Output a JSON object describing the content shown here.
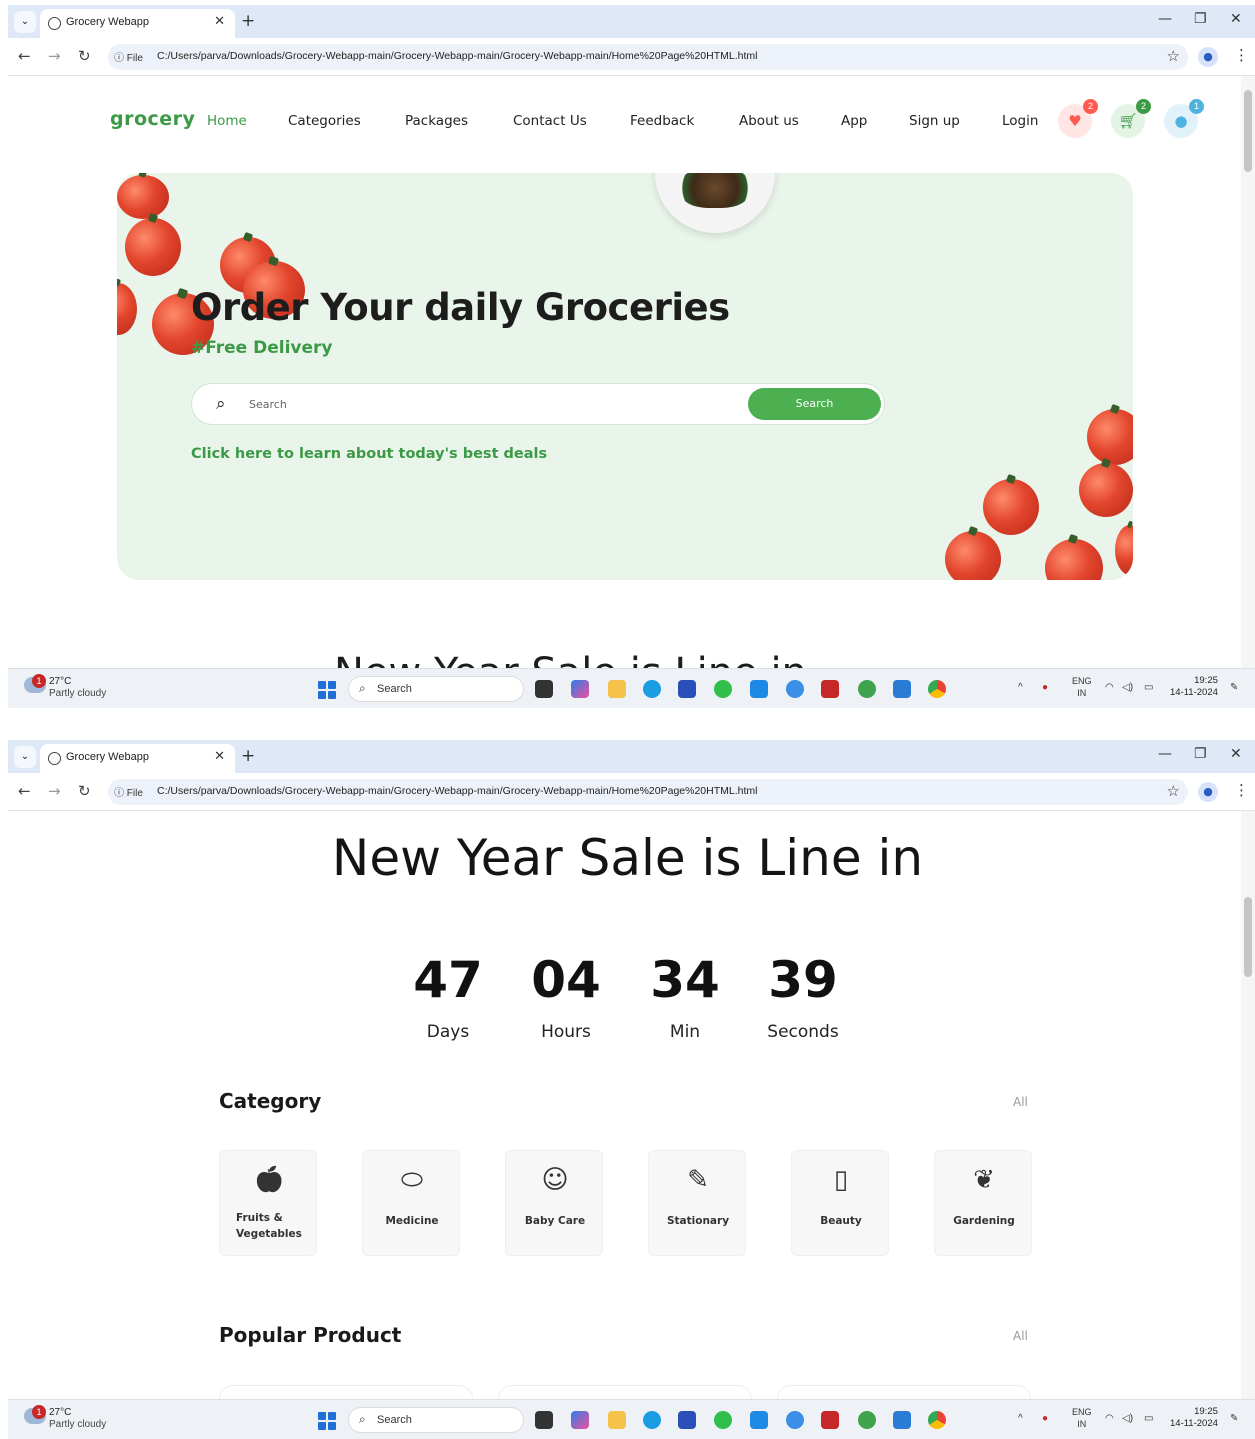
{
  "browser": {
    "tab_title": "Grocery Webapp",
    "url_scheme": "File",
    "url": "C:/Users/parva/Downloads/Grocery-Webapp-main/Grocery-Webapp-main/Grocery-Webapp-main/Home%20Page%20HTML.html"
  },
  "taskbar": {
    "weather_temp": "27°C",
    "weather_desc": "Partly cloudy",
    "weather_badge": "1",
    "search_label": "Search",
    "lang_top": "ENG",
    "lang_bottom": "IN",
    "time": "19:25",
    "date": "14-11-2024"
  },
  "nav": {
    "logo": "grocery",
    "links": [
      "Home",
      "Categories",
      "Packages",
      "Contact Us",
      "Feedback",
      "About us",
      "App",
      "Sign up",
      "Login"
    ],
    "wishlist_count": "2",
    "cart_count": "2",
    "user_count": "1"
  },
  "hero": {
    "title": "Order Your daily Groceries",
    "subtitle": "#Free Delivery",
    "search_placeholder": "Search",
    "search_button": "Search",
    "deals_link": "Click here to learn about today's best deals"
  },
  "sale": {
    "title": "New Year Sale is Line in",
    "countdown": [
      {
        "value": "47",
        "label": "Days"
      },
      {
        "value": "04",
        "label": "Hours"
      },
      {
        "value": "34",
        "label": "Min"
      },
      {
        "value": "39",
        "label": "Seconds"
      }
    ]
  },
  "category": {
    "title": "Category",
    "all_label": "All",
    "items": [
      {
        "name": "Fruits & Vegetables",
        "icon": "apple-icon"
      },
      {
        "name": "Medicine",
        "icon": "pill-icon"
      },
      {
        "name": "Baby Care",
        "icon": "baby-icon"
      },
      {
        "name": "Stationary",
        "icon": "pencil-icon"
      },
      {
        "name": "Beauty",
        "icon": "lipstick-icon"
      },
      {
        "name": "Gardening",
        "icon": "plant-icon"
      }
    ]
  },
  "popular": {
    "title": "Popular Product",
    "all_label": "All"
  },
  "colors": {
    "brand_green": "#3c9a46",
    "button_green": "#4caf50",
    "hero_bg": "#e9f5ea",
    "wishlist_red": "#ff5a4e",
    "user_blue": "#4fb3e0"
  }
}
